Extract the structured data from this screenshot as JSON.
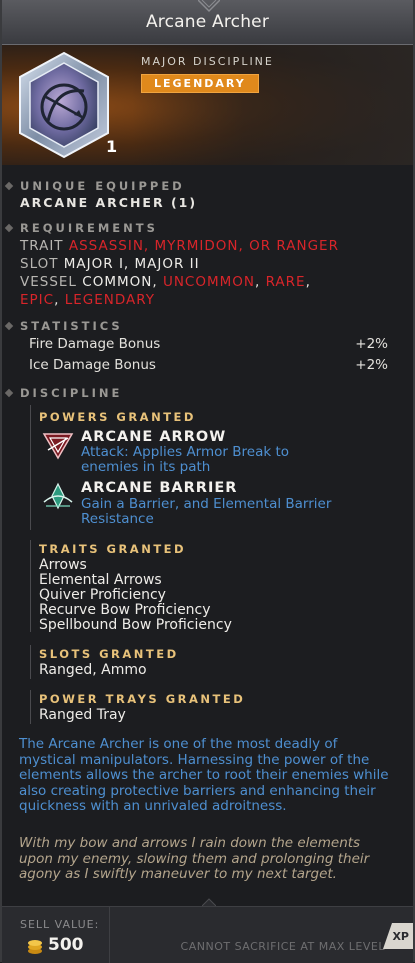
{
  "title": "Arcane Archer",
  "header": {
    "category": "MAJOR DISCIPLINE",
    "rarity": "LEGENDARY",
    "count": "1",
    "icon": "arcane-archer-bow-gem-icon"
  },
  "sections": {
    "unique": {
      "label": "UNIQUE EQUIPPED",
      "value": "ARCANE ARCHER (1)"
    },
    "requirements": {
      "label": "REQUIREMENTS",
      "trait_key": "TRAIT",
      "trait_value": "ASSASSIN, MYRMIDON, OR RANGER",
      "slot_key": "SLOT",
      "slot_value": "MAJOR I, MAJOR II",
      "vessel_key": "VESSEL",
      "vessel_common": "COMMON",
      "vessel_uncommon": "UNCOMMON",
      "vessel_rare": "RARE",
      "vessel_epic": "EPIC",
      "vessel_legendary": "LEGENDARY",
      "sep": ","
    },
    "statistics": {
      "label": "STATISTICS",
      "rows": [
        {
          "name": "Fire Damage Bonus",
          "value": "+2%"
        },
        {
          "name": "Ice Damage Bonus",
          "value": "+2%"
        }
      ]
    },
    "discipline": {
      "label": "DISCIPLINE",
      "powers_label": "POWERS GRANTED",
      "powers": [
        {
          "name": "ARCANE ARROW",
          "desc": "Attack: Applies Armor Break to enemies in its path",
          "icon": "arcane-arrow-icon"
        },
        {
          "name": "ARCANE BARRIER",
          "desc": "Gain a Barrier, and Elemental Barrier Resistance",
          "icon": "arcane-barrier-icon"
        }
      ],
      "traits_label": "TRAITS GRANTED",
      "traits": [
        "Arrows",
        "Elemental Arrows",
        "Quiver Proficiency",
        "Recurve Bow Proficiency",
        "Spellbound Bow Proficiency"
      ],
      "slots_label": "SLOTS GRANTED",
      "slots": "Ranged, Ammo",
      "trays_label": "POWER TRAYS GRANTED",
      "trays": "Ranged Tray"
    }
  },
  "description": "The Arcane Archer is one of the most deadly of mystical manipulators. Harnessing the power of the elements allows the archer to root their enemies while also creating protective barriers and enhancing their quickness with an unrivaled adroitness.",
  "flavor": "With my bow and arrows I rain down the elements upon my enemy, slowing them and prolonging their agony as I swiftly maneuver to my next target.",
  "footer": {
    "sell_label": "SELL VALUE:",
    "sell_value": "500",
    "notice": "CANNOT SACRIFICE AT MAX LEVEL",
    "xp": "XP"
  },
  "colors": {
    "rarity": "#e0891c",
    "requirement_red": "#d8252a",
    "description_blue": "#4e8fd0",
    "subheader_gold": "#e8c27a"
  }
}
